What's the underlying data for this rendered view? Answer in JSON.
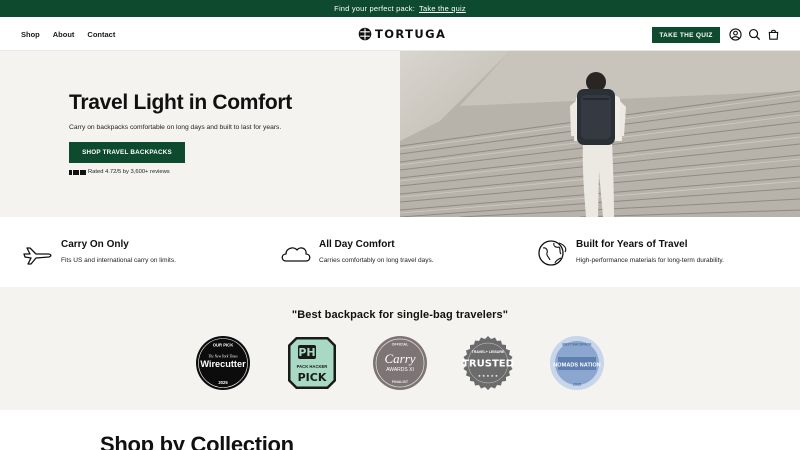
{
  "announcement": {
    "text": "Find your perfect pack:",
    "link": "Take the quiz"
  },
  "header": {
    "nav": [
      "Shop",
      "About",
      "Contact"
    ],
    "logo": "TORTUGA",
    "quiz_button": "TAKE THE QUIZ",
    "icons": [
      "account-icon",
      "search-icon",
      "cart-icon"
    ]
  },
  "hero": {
    "title": "Travel Light in Comfort",
    "subtitle": "Carry on backpacks comfortable on long days and built to last for years.",
    "button": "SHOP TRAVEL BACKPACKS",
    "rating": "Rated 4.72/5 by 3,600+ reviews",
    "rating_icon": "rating-stars-icon"
  },
  "features": [
    {
      "icon": "airplane-icon",
      "title": "Carry On Only",
      "desc": "Fits US and international carry on limits."
    },
    {
      "icon": "cloud-icon",
      "title": "All Day Comfort",
      "desc": "Carries comfortably on long travel days."
    },
    {
      "icon": "globe-icon",
      "title": "Built for Years of Travel",
      "desc": "High-performance materials for long-term durability."
    }
  ],
  "press": {
    "quote": "\"Best backpack for single-bag travelers\"",
    "badges": [
      {
        "name": "wirecutter",
        "top": "OUR PICK",
        "sub": "The New York Times",
        "main": "Wirecutter",
        "year": "2025"
      },
      {
        "name": "pack-hacker",
        "logo": "PH",
        "sub": "PACK HACKER",
        "main": "PICK"
      },
      {
        "name": "carry-awards",
        "top": "OFFICIAL",
        "main": "Carry",
        "sub": "AWARDS XI",
        "bottom": "FINALIST"
      },
      {
        "name": "travel-leisure",
        "top": "TRAVEL+ LEISURE",
        "main": "TRUSTED"
      },
      {
        "name": "nomads-nation",
        "top": "BEST BACKPACK",
        "main": "NOMADS NATION",
        "year": "2025"
      }
    ]
  },
  "collection": {
    "title": "Shop by Collection"
  },
  "colors": {
    "brand_green": "#0d4a2e",
    "section_bg": "#f4f3ef"
  }
}
